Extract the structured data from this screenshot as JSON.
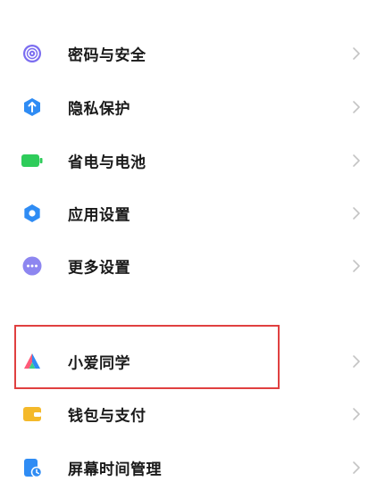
{
  "settings": {
    "items": [
      {
        "label": "密码与安全",
        "icon": "fingerprint-icon",
        "color": "#7a6cf0"
      },
      {
        "label": "隐私保护",
        "icon": "privacy-shield-icon",
        "color": "#2f8cf4"
      },
      {
        "label": "省电与电池",
        "icon": "battery-icon",
        "color": "#2ecc5a"
      },
      {
        "label": "应用设置",
        "icon": "gear-icon",
        "color": "#2f8cf4"
      },
      {
        "label": "更多设置",
        "icon": "more-dots-icon",
        "color": "#8d86f0"
      },
      {
        "label": "小爱同学",
        "icon": "xiaoai-icon",
        "color": "#2f8cf4"
      },
      {
        "label": "钱包与支付",
        "icon": "wallet-icon",
        "color": "#f4b92a"
      },
      {
        "label": "屏幕时间管理",
        "icon": "screen-time-icon",
        "color": "#2f8cf4"
      }
    ]
  },
  "annotation": {
    "color": "#e04040"
  }
}
